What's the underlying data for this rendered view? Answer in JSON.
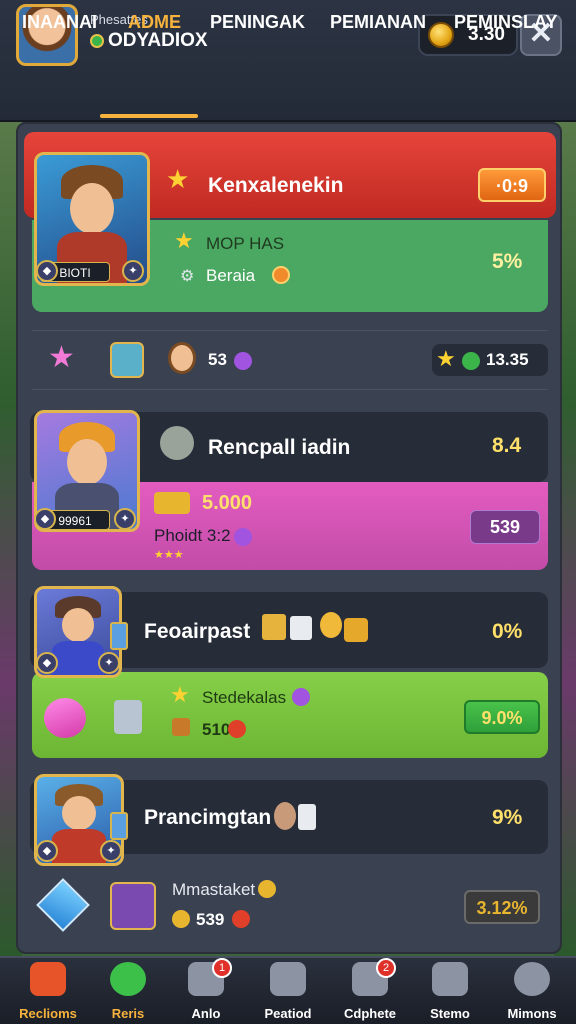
{
  "header": {
    "profile_sub": "Phesattes",
    "profile_name": "ODYADIOX",
    "coins": "3.30",
    "close_symbol": "✕"
  },
  "tabs": [
    {
      "label": "INAANAI"
    },
    {
      "label": "ADME"
    },
    {
      "label": "PENINGAK"
    },
    {
      "label": "PEMIANAN"
    },
    {
      "label": "PEMINSLAY"
    }
  ],
  "cards": {
    "c1": {
      "hero_tag": "BIOTI",
      "title": "Kenxalenekin",
      "pill": "·0:9",
      "line1": "MOP HAS",
      "line2": "Beraia",
      "value": "5%"
    },
    "row1": {
      "level": "53",
      "value": "13.35"
    },
    "c2": {
      "hero_tag": "99961",
      "title": "Rencpall iadin",
      "value": "8.4",
      "line1": "5.000",
      "line2": "Phoidt 3:2",
      "pill": "539"
    },
    "c3": {
      "title": "Feoairpast",
      "value": "0%",
      "line1": "Stedekalas",
      "line2": "510",
      "pill": "9.0%"
    },
    "c4": {
      "title": "Prancimgtan",
      "value": "9%",
      "line1": "Mmastaket",
      "line2": "539",
      "pill": "3.12%"
    }
  },
  "nav": [
    {
      "label": "Reclioms",
      "badge": ""
    },
    {
      "label": "Reris",
      "badge": ""
    },
    {
      "label": "Anlo",
      "badge": "1"
    },
    {
      "label": "Peatiod",
      "badge": ""
    },
    {
      "label": "Cdphete",
      "badge": "2"
    },
    {
      "label": "Stemo",
      "badge": ""
    },
    {
      "label": "Mimons",
      "badge": ""
    }
  ],
  "colors": {
    "accent": "#f6b23c",
    "red_card": "#d8382c",
    "green_card": "#4aa860",
    "pink_card": "#d956b4",
    "lime_card": "#79c43c"
  }
}
